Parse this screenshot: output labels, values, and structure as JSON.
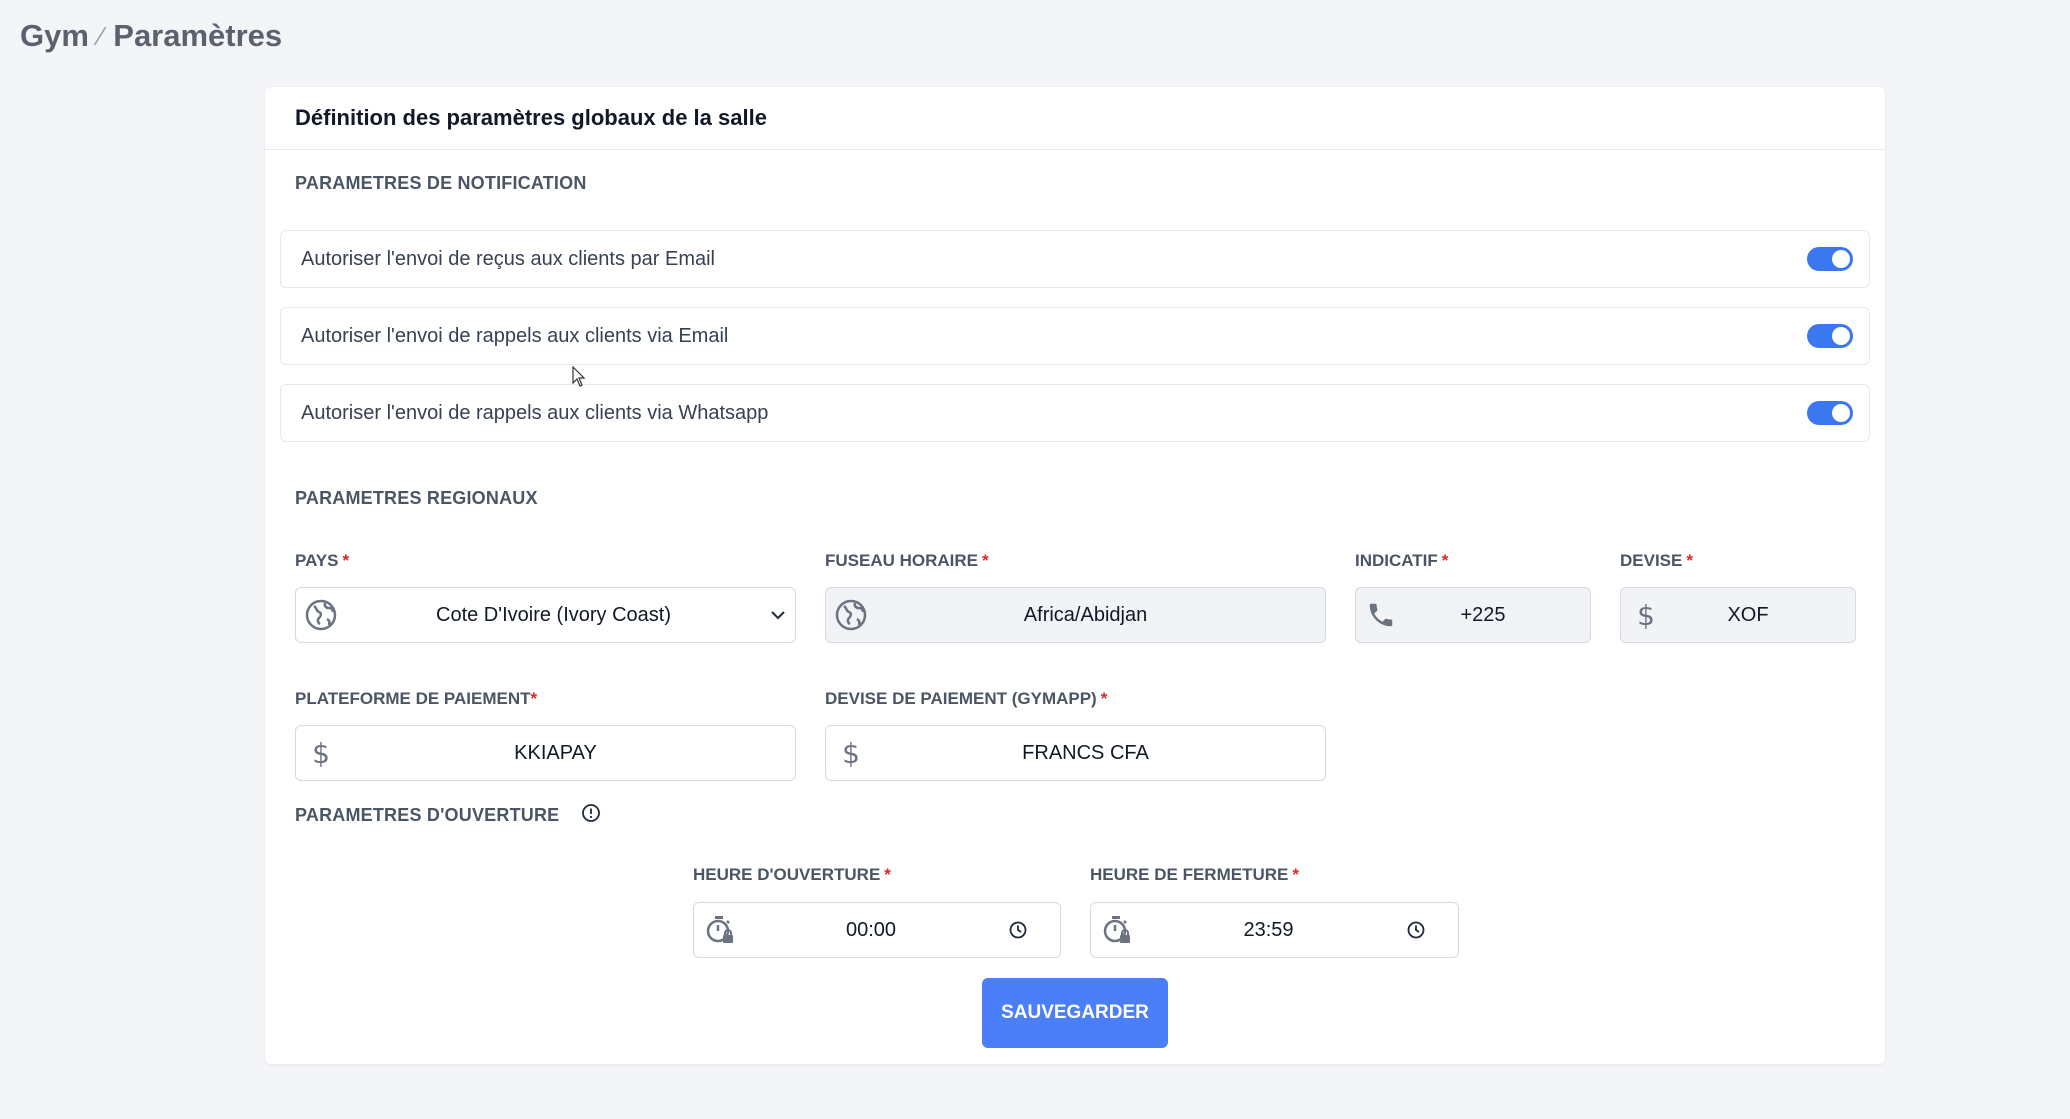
{
  "breadcrumb": {
    "root": "Gym",
    "separator": "⁄",
    "current": "Paramètres"
  },
  "card": {
    "title": "Définition des paramètres globaux de la salle"
  },
  "notifications": {
    "section_title": "PARAMETRES DE NOTIFICATION",
    "toggles": [
      {
        "label": "Autoriser l'envoi de reçus aux clients par Email",
        "enabled": true
      },
      {
        "label": "Autoriser l'envoi de rappels aux clients via Email",
        "enabled": true
      },
      {
        "label": "Autoriser l'envoi de rappels aux clients via Whatsapp",
        "enabled": true
      }
    ]
  },
  "regional": {
    "section_title": "PARAMETRES REGIONAUX",
    "pays": {
      "label": "PAYS",
      "value": "Cote D'Ivoire (Ivory Coast)"
    },
    "fuseau": {
      "label": "FUSEAU HORAIRE",
      "value": "Africa/Abidjan"
    },
    "indicatif": {
      "label": "INDICATIF",
      "value": "+225"
    },
    "devise": {
      "label": "DEVISE",
      "value": "XOF"
    },
    "plateforme": {
      "label": "PLATEFORME DE PAIEMENT",
      "value": "KKIAPAY"
    },
    "devise_paiement": {
      "label": "DEVISE DE PAIEMENT (GYMAPP)",
      "value": "FRANCS CFA"
    }
  },
  "opening": {
    "section_title": "PARAMETRES D'OUVERTURE",
    "ouverture": {
      "label": "HEURE D'OUVERTURE",
      "value": "00:00"
    },
    "fermeture": {
      "label": "HEURE DE FERMETURE",
      "value": "23:59"
    }
  },
  "required_mark": "*",
  "save_label": "SAUVEGARDER",
  "colors": {
    "accent": "#4a7ff7",
    "toggle_on": "#3b78f0",
    "required": "#e02424"
  }
}
